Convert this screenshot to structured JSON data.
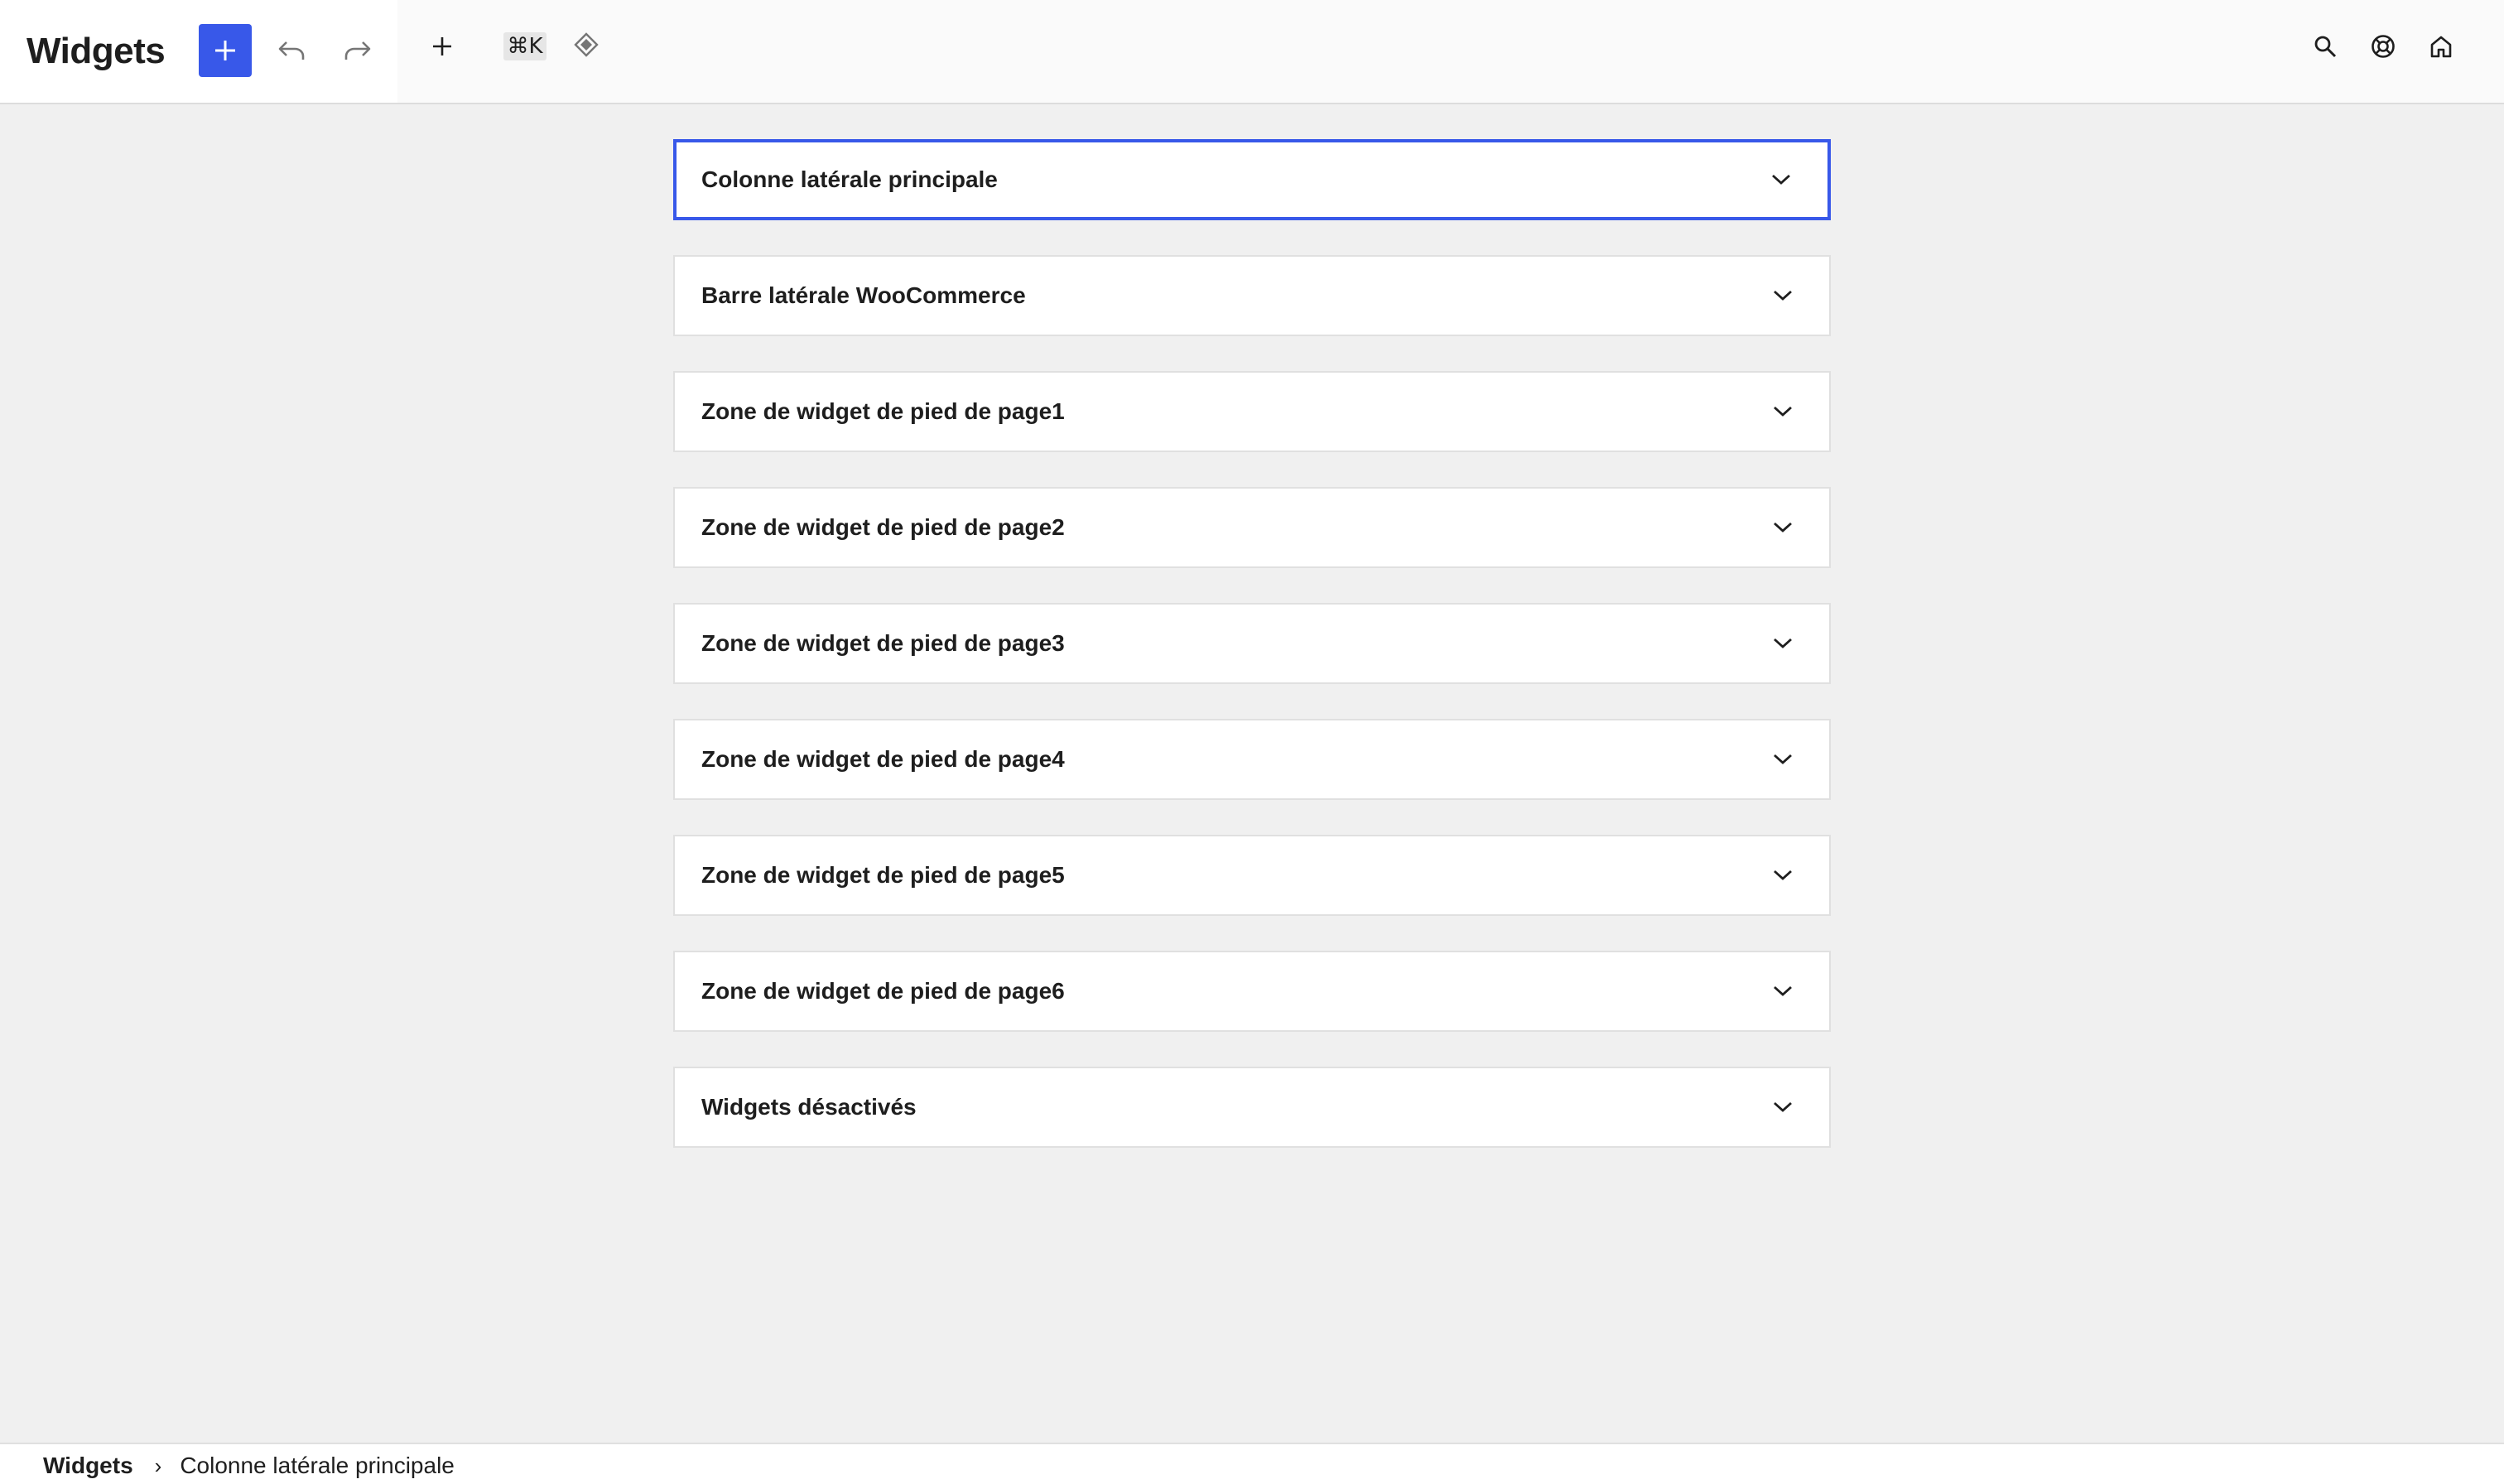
{
  "header": {
    "title": "Widgets",
    "toolbar": {
      "add_block_icon": "plus-icon",
      "undo_icon": "undo-icon",
      "redo_icon": "redo-icon",
      "plus_icon": "plus-icon",
      "shortcut_label": "⌘K",
      "diamond_icon": "diamond-icon"
    },
    "right_actions": {
      "search_icon": "search-icon",
      "help_icon": "help-lifebuoy-icon",
      "home_icon": "home-icon"
    }
  },
  "widget_areas": [
    {
      "label": "Colonne latérale principale",
      "selected": true
    },
    {
      "label": "Barre latérale WooCommerce",
      "selected": false
    },
    {
      "label": "Zone de widget de pied de page1",
      "selected": false
    },
    {
      "label": "Zone de widget de pied de page2",
      "selected": false
    },
    {
      "label": "Zone de widget de pied de page3",
      "selected": false
    },
    {
      "label": "Zone de widget de pied de page4",
      "selected": false
    },
    {
      "label": "Zone de widget de pied de page5",
      "selected": false
    },
    {
      "label": "Zone de widget de pied de page6",
      "selected": false
    },
    {
      "label": "Widgets désactivés",
      "selected": false
    }
  ],
  "breadcrumb": {
    "root": "Widgets",
    "separator": "›",
    "current": "Colonne latérale principale"
  },
  "colors": {
    "accent": "#3858e9",
    "background": "#f0f0f0",
    "panel": "#ffffff",
    "text": "#1e1e1e"
  }
}
